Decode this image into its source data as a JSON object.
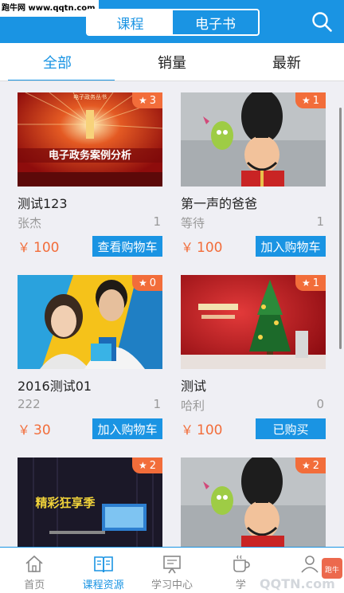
{
  "watermark": "跑牛网 www.qqtn.com",
  "header": {
    "tabs": [
      {
        "label": "课程",
        "active": true
      },
      {
        "label": "电子书",
        "active": false
      }
    ],
    "search_icon": "search-icon"
  },
  "filters": [
    {
      "label": "全部",
      "active": true
    },
    {
      "label": "销量",
      "active": false
    },
    {
      "label": "最新",
      "active": false
    }
  ],
  "courses": [
    {
      "title": "测试123",
      "author": "张杰",
      "count": "1",
      "price": "100",
      "currency": "￥",
      "rating": "3",
      "button": "查看购物车",
      "thumb_text": "电子政务案例分析",
      "thumb_top": "电子政务丛书"
    },
    {
      "title": "第一声的爸爸",
      "author": "等待",
      "count": "1",
      "price": "100",
      "currency": "￥",
      "rating": "1",
      "button": "加入购物车"
    },
    {
      "title": "2016测试01",
      "author": "222",
      "count": "1",
      "price": "30",
      "currency": "￥",
      "rating": "0",
      "button": "加入购物车"
    },
    {
      "title": "测试",
      "author": "哈利",
      "count": "0",
      "price": "100",
      "currency": "￥",
      "rating": "1",
      "button": "已购买"
    },
    {
      "rating": "2",
      "thumb_text": "精彩狂享季"
    },
    {
      "rating": "2"
    }
  ],
  "bottom_nav": [
    {
      "label": "首页",
      "icon": "home-icon",
      "active": false
    },
    {
      "label": "课程资源",
      "icon": "book-icon",
      "active": true
    },
    {
      "label": "学习中心",
      "icon": "board-icon",
      "active": false
    },
    {
      "label": "学",
      "icon": "cup-icon",
      "active": false
    },
    {
      "label": "",
      "icon": "user-icon",
      "active": false
    }
  ],
  "corner_watermark": "QQTN.com",
  "corner_badge": "跑牛"
}
